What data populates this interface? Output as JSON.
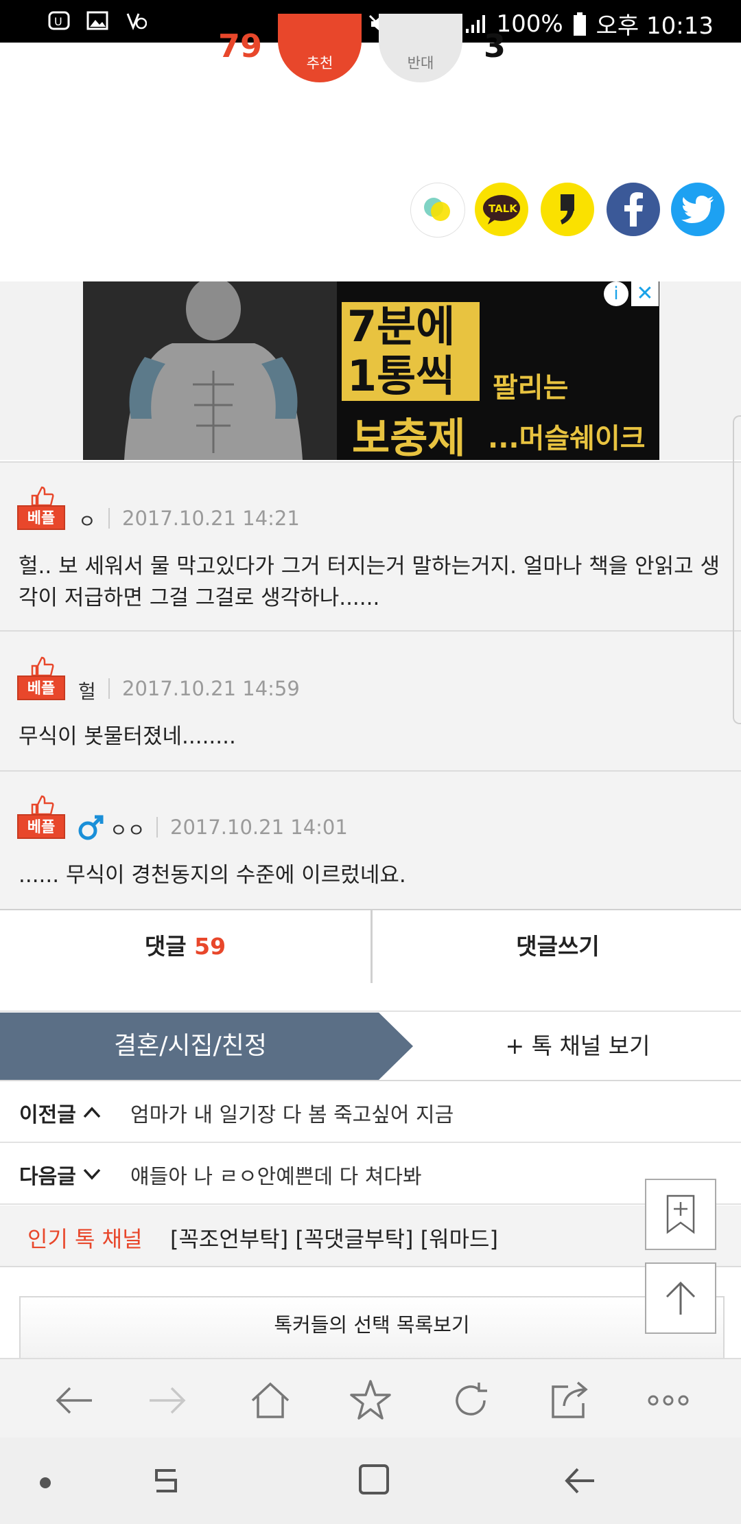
{
  "status_bar": {
    "battery": "100%",
    "time": "오후 10:13"
  },
  "vote": {
    "recommend_count": "79",
    "recommend_label": "추천",
    "oppose_label": "반대",
    "oppose_count": "3"
  },
  "share": {
    "items": [
      "kakaostory",
      "kakaotalk",
      "kakaopage",
      "facebook",
      "twitter"
    ],
    "talk_label": "TALK"
  },
  "ad": {
    "line1": "7분에",
    "line2": "1통씩",
    "line3": "팔리는",
    "line4": "보충제",
    "line5": "...머슬쉐이크",
    "info": "i",
    "close": "✕"
  },
  "comments": [
    {
      "badge": "베플",
      "name": "ㅇ",
      "date": "2017.10.21 14:21",
      "text": "헐.. 보 세워서 물 막고있다가 그거 터지는거 말하는거지. 얼마나 책을 안읽고 생각이 저급하면 그걸 그걸로 생각하나......"
    },
    {
      "badge": "베플",
      "name": "헐",
      "date": "2017.10.21 14:59",
      "text": "무식이 봇물터졌네........"
    },
    {
      "badge": "베플",
      "name": "ㅇㅇ",
      "date": "2017.10.21 14:01",
      "text": "...... 무식이 경천동지의 수준에 이르렀네요."
    }
  ],
  "comment_bar": {
    "comments_label": "댓글",
    "comments_count": "59",
    "write_label": "댓글쓰기"
  },
  "channel": {
    "name": "결혼/시집/친정",
    "view_label": "+ 톡 채널 보기"
  },
  "prev_post": {
    "label": "이전글",
    "title": "엄마가 내 일기장 다 봄 죽고싶어 지금"
  },
  "next_post": {
    "label": "다음글",
    "title": "얘들아 나 ㄹㅇ안예쁜데 다 쳐다봐"
  },
  "popular": {
    "label": "인기 톡 채널",
    "channels": "[꼭조언부탁] [꼭댓글부탁] [워마드]"
  },
  "talkers_choice": "톡커들의 선택 목록보기",
  "colors": {
    "accent": "#e8472b",
    "channel_bg": "#5b6f86",
    "facebook": "#3b5998",
    "twitter": "#1da1f2",
    "kakao": "#fae100"
  }
}
